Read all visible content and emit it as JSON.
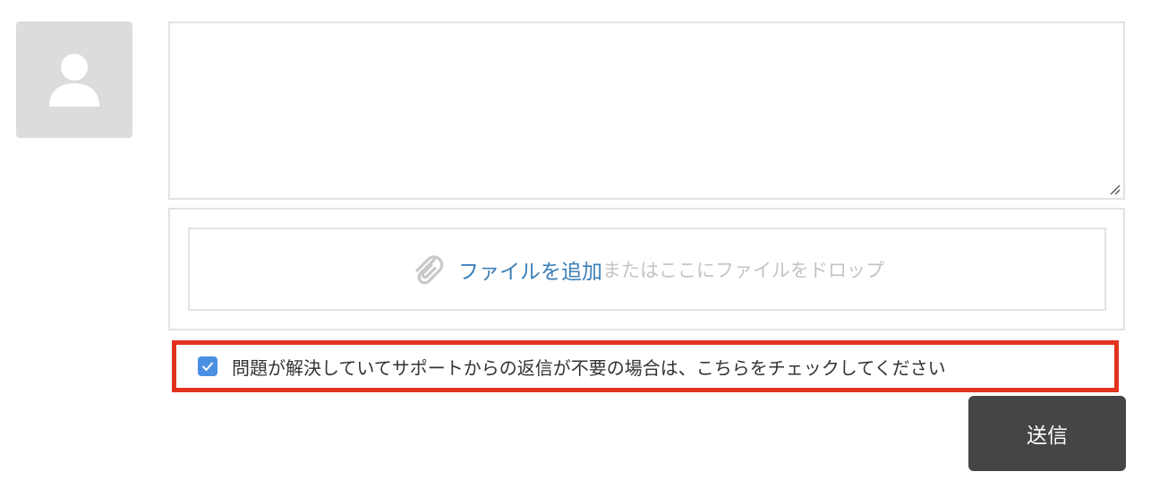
{
  "comment": {
    "value": "",
    "placeholder": ""
  },
  "upload": {
    "link_label": "ファイルを追加",
    "hint": "またはここにファイルをドロップ",
    "icon": "paperclip-icon"
  },
  "resolved_checkbox": {
    "checked": true,
    "label": "問題が解決していてサポートからの返信が不要の場合は、こちらをチェックしてください"
  },
  "actions": {
    "send_label": "送信"
  },
  "colors": {
    "link": "#3b7fb8",
    "checkbox": "#4a90e2",
    "highlight_border": "#e2321f",
    "button_bg": "#454545"
  }
}
